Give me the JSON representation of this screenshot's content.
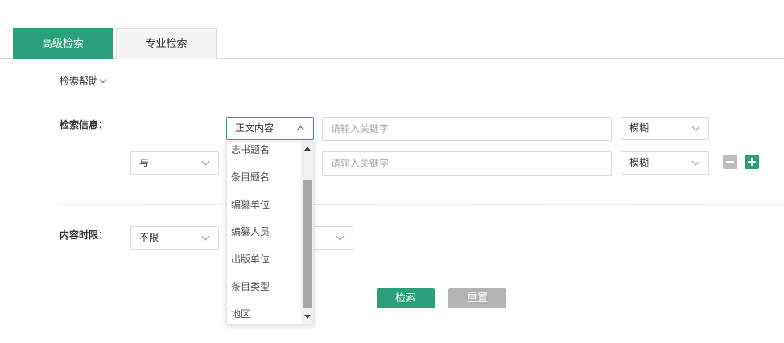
{
  "tabs": [
    {
      "label": "高级检索",
      "active": true
    },
    {
      "label": "专业检索",
      "active": false
    }
  ],
  "help": {
    "label": "检索帮助"
  },
  "search_info": {
    "label": "检索信息：",
    "row1": {
      "field": "正文内容",
      "placeholder": "请输入关键字",
      "match": "模糊"
    },
    "row2": {
      "logic": "与",
      "placeholder": "请输入关键字",
      "match": "模糊"
    }
  },
  "dropdown": {
    "items": [
      "志书题名",
      "条目题名",
      "编纂单位",
      "编纂人员",
      "出版单位",
      "条目类型",
      "地区"
    ]
  },
  "content_time": {
    "label": "内容时限：",
    "value": "不限",
    "second_value": ""
  },
  "actions": {
    "search": "检索",
    "reset": "重置"
  },
  "colors": {
    "accent": "#2aa07a",
    "reset": "#b3b3b3",
    "minus": "#bdbdbd"
  }
}
